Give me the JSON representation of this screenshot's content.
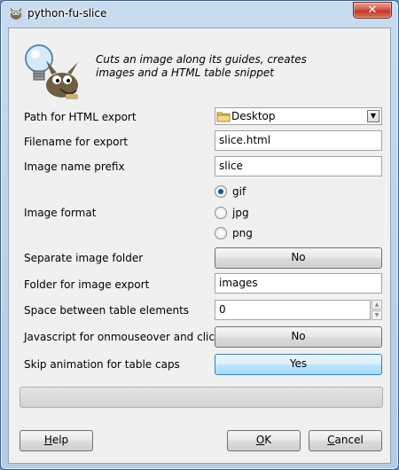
{
  "window": {
    "title": "python-fu-slice",
    "close_glyph": "✕"
  },
  "header": {
    "icon": "wilber-lightbulb-icon",
    "description": "Cuts an image along its guides, creates images and a HTML table snippet"
  },
  "form": {
    "path": {
      "label": "Path for HTML export",
      "value": "Desktop",
      "icon": "folder-icon"
    },
    "filename": {
      "label": "Filename for export",
      "value": "slice.html"
    },
    "prefix": {
      "label": "Image name prefix",
      "value": "slice"
    },
    "format": {
      "label": "Image format",
      "options": [
        "gif",
        "jpg",
        "png"
      ],
      "selected": "gif"
    },
    "separate_folder": {
      "label": "Separate image folder",
      "value": "No"
    },
    "folder": {
      "label": "Folder for image export",
      "value": "images"
    },
    "space": {
      "label": "Space between table elements",
      "value": "0"
    },
    "javascript": {
      "label": "Javascript for onmouseover and clicked",
      "value": "No"
    },
    "skip_caps": {
      "label": "Skip animation for table caps",
      "value": "Yes"
    }
  },
  "progress": {
    "fraction": 0
  },
  "buttons": {
    "help": {
      "label": "Help",
      "mnemonic": "H",
      "rest": "elp"
    },
    "ok": {
      "label": "OK",
      "mnemonic": "O",
      "rest": "K"
    },
    "cancel": {
      "label": "Cancel",
      "mnemonic": "C",
      "rest": "ancel"
    }
  },
  "colors": {
    "title_bar": "#c9dbee",
    "close_button": "#c13a26",
    "active_toggle": "#bee6fd",
    "radio_dot": "#1f4f8c"
  }
}
